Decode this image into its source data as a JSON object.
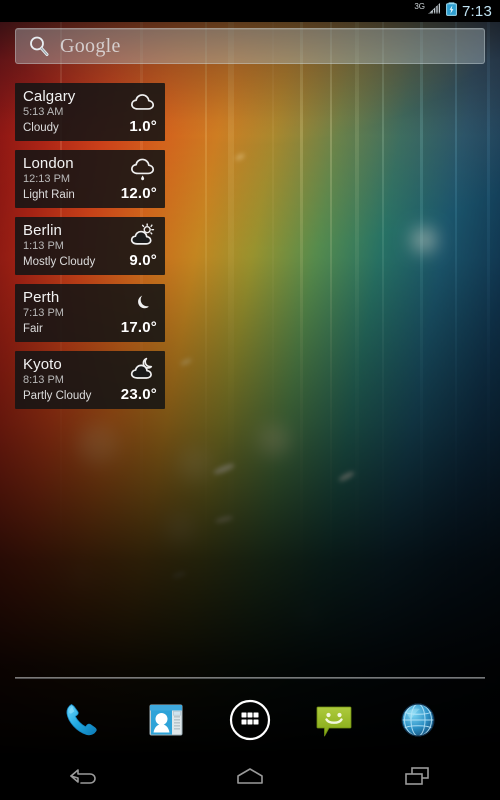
{
  "status_bar": {
    "network_label": "3G",
    "clock": "7:13",
    "signal_icon": "signal-bars-icon",
    "battery_icon": "battery-charging-icon"
  },
  "search": {
    "placeholder": "Google",
    "icon": "search-icon"
  },
  "weather_widget": {
    "cards": [
      {
        "city": "Calgary",
        "time": "5:13 AM",
        "condition": "Cloudy",
        "temperature": "1.0°",
        "icon": "cloudy-icon"
      },
      {
        "city": "London",
        "time": "12:13 PM",
        "condition": "Light Rain",
        "temperature": "12.0°",
        "icon": "rain-icon"
      },
      {
        "city": "Berlin",
        "time": "1:13 PM",
        "condition": "Mostly Cloudy",
        "temperature": "9.0°",
        "icon": "sun-behind-cloud-icon"
      },
      {
        "city": "Perth",
        "time": "7:13 PM",
        "condition": "Fair",
        "temperature": "17.0°",
        "icon": "moon-icon"
      },
      {
        "city": "Kyoto",
        "time": "8:13 PM",
        "condition": "Partly Cloudy",
        "temperature": "23.0°",
        "icon": "moon-behind-cloud-icon"
      }
    ]
  },
  "dock": {
    "items": [
      {
        "label": "Phone",
        "icon": "phone-icon"
      },
      {
        "label": "People",
        "icon": "contacts-icon"
      },
      {
        "label": "All Apps",
        "icon": "all-apps-icon"
      },
      {
        "label": "Messaging",
        "icon": "messaging-icon"
      },
      {
        "label": "Browser",
        "icon": "browser-globe-icon"
      }
    ]
  },
  "nav_bar": {
    "buttons": [
      {
        "label": "Back",
        "icon": "back-arrow-icon"
      },
      {
        "label": "Home",
        "icon": "home-icon"
      },
      {
        "label": "Recents",
        "icon": "recents-icon"
      }
    ]
  },
  "colors": {
    "accent_blue": "#33b5e5",
    "messaging_green": "#9bbb2e",
    "card_background": "#141414",
    "status_clock": "#bfe2f2"
  }
}
